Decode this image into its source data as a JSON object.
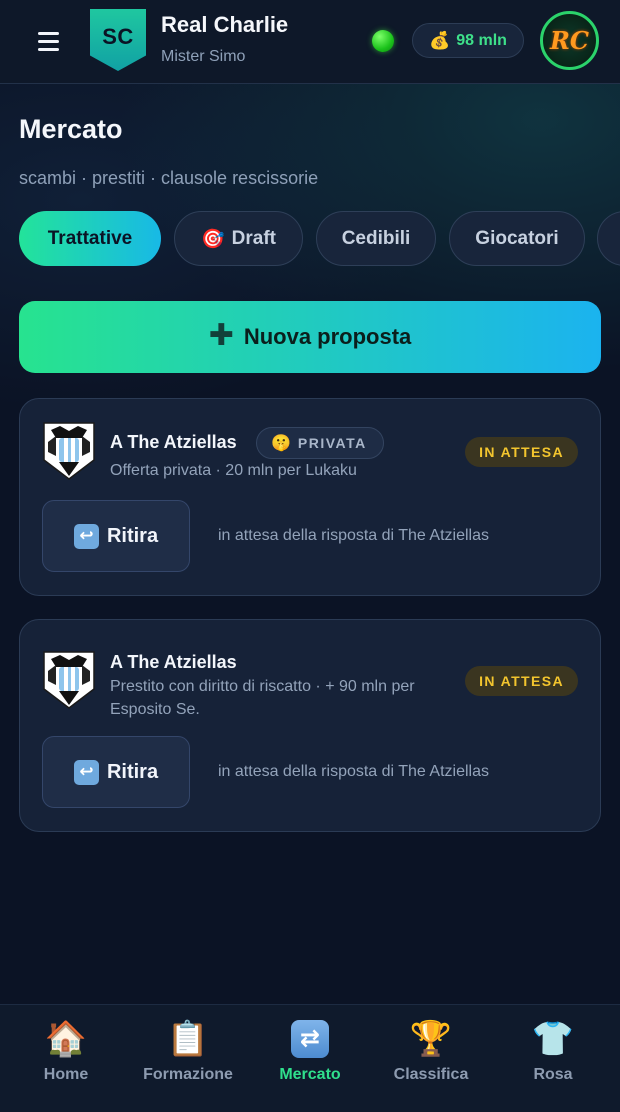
{
  "header": {
    "team_badge": "SC",
    "team_name": "Real Charlie",
    "owner": "Mister Simo",
    "online_status_color": "#22c31c",
    "budget_icon": "💰",
    "budget": "98 mln",
    "avatar_initials": "RC"
  },
  "page": {
    "title": "Mercato",
    "subtitle": "scambi · prestiti · clausole rescissorie"
  },
  "tabs": [
    {
      "label": "Trattative",
      "icon": "",
      "active": true
    },
    {
      "label": "Draft",
      "icon": "🎯",
      "active": false
    },
    {
      "label": "Cedibili",
      "icon": "",
      "active": false
    },
    {
      "label": "Giocatori",
      "icon": "",
      "active": false
    }
  ],
  "new_proposal": {
    "icon": "✚",
    "label": "Nuova proposta"
  },
  "offers": [
    {
      "title": "A The Atziellas",
      "private_badge": {
        "icon": "🤫",
        "label": "PRIVATA"
      },
      "description": "Offerta privata · 20 mln per Lukaku",
      "status": "IN ATTESA",
      "withdraw_icon": "↩",
      "withdraw_label": "Ritira",
      "waiting_text": "in attesa della risposta di The Atziellas"
    },
    {
      "title": "A The Atziellas",
      "description": "Prestito con diritto di riscatto · + 90 mln per Esposito Se.",
      "status": "IN ATTESA",
      "withdraw_icon": "↩",
      "withdraw_label": "Ritira",
      "waiting_text": "in attesa della risposta di The Atziellas"
    }
  ],
  "bottom_nav": [
    {
      "label": "Home",
      "icon": "🏠",
      "active": false
    },
    {
      "label": "Formazione",
      "icon": "📋",
      "active": false
    },
    {
      "label": "Mercato",
      "icon": "🔁",
      "active": true
    },
    {
      "label": "Classifica",
      "icon": "🏆",
      "active": false
    },
    {
      "label": "Rosa",
      "icon": "👕",
      "active": false
    }
  ],
  "colors": {
    "accent_green": "#2fe08c",
    "accent_blue": "#18b9e6",
    "status_pending": "#f3c52e",
    "background": "#0b1325"
  }
}
